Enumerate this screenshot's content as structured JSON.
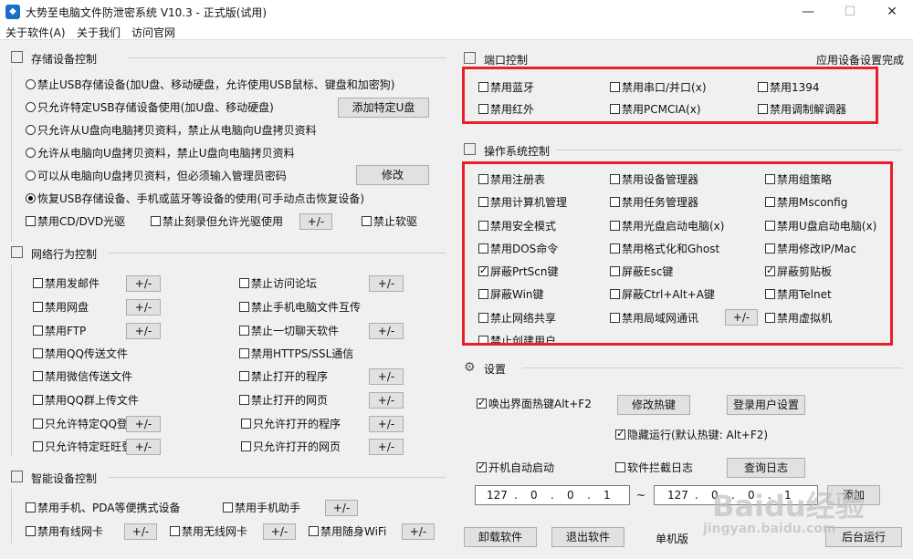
{
  "window": {
    "title": "大势至电脑文件防泄密系统 V10.3 - 正式版(试用)",
    "app_icon": "shield-app-icon"
  },
  "menu": {
    "items": [
      "关于软件(A)",
      "关于我们",
      "访问官网"
    ]
  },
  "storage": {
    "title": "存储设备控制",
    "options": [
      "禁止USB存储设备(加U盘、移动硬盘，允许使用USB鼠标、键盘和加密狗)",
      "只允许特定USB存储设备使用(加U盘、移动硬盘)",
      "只允许从U盘向电脑拷贝资料，禁止从电脑向U盘拷贝资料",
      "允许从电脑向U盘拷贝资料，禁止U盘向电脑拷贝资料",
      "可以从电脑向U盘拷贝资料，但必须输入管理员密码",
      "恢复USB存储设备、手机或蓝牙等设备的使用(可手动点击恢复设备)"
    ],
    "selected_index": 5,
    "add_udisk_label": "添加特定U盘",
    "modify_label": "修改",
    "cd_label": "禁用CD/DVD光驱",
    "burn_label": "禁止刻录但允许光驱使用",
    "pm_label": "+/-",
    "floppy_label": "禁止软驱"
  },
  "network": {
    "title": "网络行为控制",
    "left": [
      {
        "label": "禁用发邮件",
        "pm": "+/-"
      },
      {
        "label": "禁用网盘",
        "pm": "+/-"
      },
      {
        "label": "禁用FTP",
        "pm": "+/-"
      },
      {
        "label": "禁用QQ传送文件",
        "pm": ""
      },
      {
        "label": "禁用微信传送文件",
        "pm": ""
      },
      {
        "label": "禁用QQ群上传文件",
        "pm": ""
      },
      {
        "label": "只允许特定QQ登录",
        "pm": "+/-"
      },
      {
        "label": "只允许特定旺旺登录",
        "pm": "+/-"
      }
    ],
    "right": [
      {
        "label": "禁止访问论坛",
        "pm": "+/-"
      },
      {
        "label": "禁止手机电脑文件互传",
        "pm": ""
      },
      {
        "label": "禁止一切聊天软件",
        "pm": "+/-"
      },
      {
        "label": "禁用HTTPS/SSL通信",
        "pm": ""
      },
      {
        "label": "禁止打开的程序",
        "pm": "+/-"
      },
      {
        "label": "禁止打开的网页",
        "pm": "+/-"
      },
      {
        "label": "只允许打开的程序",
        "pm": "+/-"
      },
      {
        "label": "只允许打开的网页",
        "pm": "+/-"
      }
    ]
  },
  "smart": {
    "title": "智能设备控制",
    "phone_label": "禁用手机、PDA等便携式设备",
    "assistant_label": "禁用手机助手",
    "wired_label": "禁用有线网卡",
    "wireless_label": "禁用无线网卡",
    "wifi_label": "禁用随身WiFi",
    "pm_label": "+/-"
  },
  "port": {
    "title": "端口控制",
    "apply_label": "应用设备设置完成",
    "items": [
      {
        "label": "禁用蓝牙",
        "checked": false
      },
      {
        "label": "禁用串口/并口(x)",
        "checked": false
      },
      {
        "label": "禁用1394",
        "checked": false
      },
      {
        "label": "禁用红外",
        "checked": false
      },
      {
        "label": "禁用PCMCIA(x)",
        "checked": false
      },
      {
        "label": "禁用调制解调器",
        "checked": false
      }
    ]
  },
  "os": {
    "title": "操作系统控制",
    "items": [
      {
        "label": "禁用注册表",
        "checked": false
      },
      {
        "label": "禁用设备管理器",
        "checked": false
      },
      {
        "label": "禁用组策略",
        "checked": false
      },
      {
        "label": "禁用计算机管理",
        "checked": false
      },
      {
        "label": "禁用任务管理器",
        "checked": false
      },
      {
        "label": "禁用Msconfig",
        "checked": false
      },
      {
        "label": "禁用安全模式",
        "checked": false
      },
      {
        "label": "禁用光盘启动电脑(x)",
        "checked": false
      },
      {
        "label": "禁用U盘启动电脑(x)",
        "checked": false
      },
      {
        "label": "禁用DOS命令",
        "checked": false
      },
      {
        "label": "禁用格式化和Ghost",
        "checked": false
      },
      {
        "label": "禁用修改IP/Mac",
        "checked": false
      },
      {
        "label": "屏蔽PrtScn键",
        "checked": true
      },
      {
        "label": "屏蔽Esc键",
        "checked": false
      },
      {
        "label": "屏蔽剪贴板",
        "checked": true
      },
      {
        "label": "屏蔽Win键",
        "checked": false
      },
      {
        "label": "屏蔽Ctrl+Alt+A键",
        "checked": false
      },
      {
        "label": "禁用Telnet",
        "checked": false
      },
      {
        "label": "禁止网络共享",
        "checked": false
      },
      {
        "label": "禁用局域网通讯",
        "checked": false
      },
      {
        "label": "禁用虚拟机",
        "checked": false
      },
      {
        "label": "禁止创建用户",
        "checked": false
      }
    ],
    "pm_label": "+/-"
  },
  "settings": {
    "title": "设置",
    "hotkey_label": "唤出界面热键Alt+F2",
    "modify_hotkey_label": "修改热键",
    "login_user_label": "登录用户设置",
    "hide_label": "隐藏运行(默认热键: Alt+F2)",
    "autostart_label": "开机自动启动",
    "block_log_label": "软件拦截日志",
    "query_log_label": "查询日志",
    "ip_from": [
      "127",
      "0",
      "0",
      "1"
    ],
    "ip_sep": "~",
    "ip_to": [
      "127",
      "0",
      "0",
      "1"
    ],
    "ip_btn_label": "添加"
  },
  "footer": {
    "uninstall_label": "卸载软件",
    "exit_label": "退出软件",
    "mode_label": "单机版",
    "background_label": "后台运行"
  },
  "watermark": {
    "brand": "Baidu经验",
    "url": "jingyan.baidu.com"
  },
  "colors": {
    "highlight": "#e8202a"
  }
}
